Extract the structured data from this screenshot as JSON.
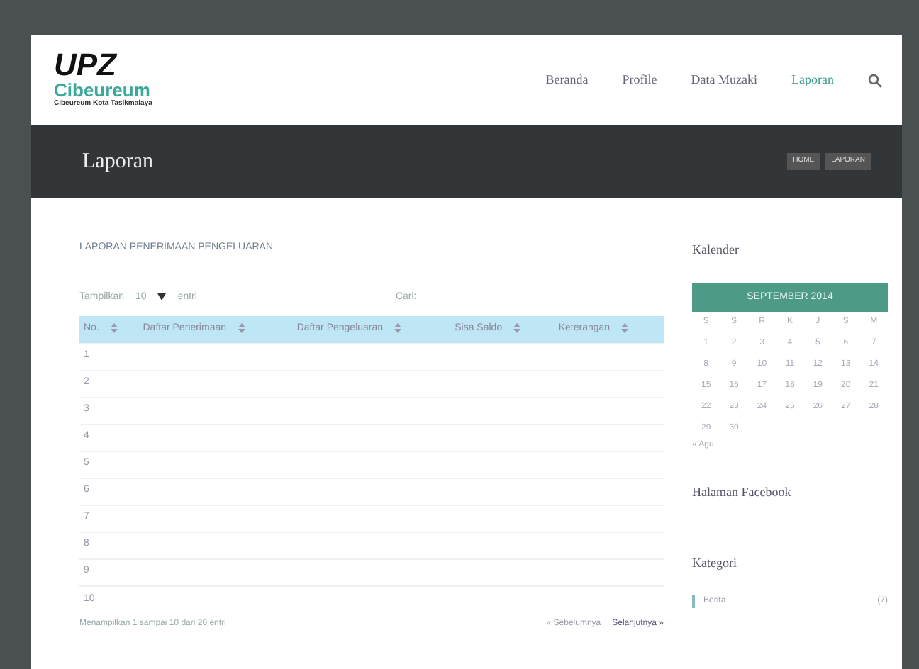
{
  "logo": {
    "mark": "UPZ",
    "name": "Cibeureum",
    "subtitle": "Cibeureum Kota Tasikmalaya"
  },
  "nav": [
    {
      "label": "Beranda",
      "selected": false
    },
    {
      "label": "Profile",
      "selected": false
    },
    {
      "label": "Data Muzaki",
      "selected": false
    },
    {
      "label": "Laporan",
      "selected": true
    }
  ],
  "page_title": "Laporan",
  "breadcrumb": [
    "HOME",
    "LAPORAN"
  ],
  "report": {
    "title": "LAPORAN PENERIMAAN PENGELUARAN",
    "show_label": "Tampilkan",
    "page_size": "10",
    "entries_label": "entri",
    "search_label": "Cari:",
    "columns": [
      "No.",
      "Daftar Penerimaan",
      "Daftar Pengeluaran",
      "Sisa Saldo",
      "Keterangan"
    ],
    "rows": [
      "1",
      "2",
      "3",
      "4",
      "5",
      "6",
      "7",
      "8",
      "9",
      "10"
    ],
    "info": "Menampilkan 1 sampai 10 dari 20 entri",
    "prev": "« Sebelumnya",
    "next": "Selanjutnya »"
  },
  "sidebar": {
    "calendar_title": "Kalender",
    "month": "SEPTEMBER 2014",
    "weekdays": [
      "S",
      "S",
      "R",
      "K",
      "J",
      "S",
      "M"
    ],
    "weeks": [
      [
        "1",
        "2",
        "3",
        "4",
        "5",
        "6",
        "7"
      ],
      [
        "8",
        "9",
        "10",
        "11",
        "12",
        "13",
        "14"
      ],
      [
        "15",
        "16",
        "17",
        "18",
        "19",
        "20",
        "21"
      ],
      [
        "22",
        "23",
        "24",
        "25",
        "26",
        "27",
        "28"
      ],
      [
        "29",
        "30"
      ]
    ],
    "prev_month": "« Agu",
    "facebook_title": "Halaman Facebook",
    "category_title": "Kategori",
    "categories": [
      {
        "name": "Berita",
        "count": "(7)"
      }
    ]
  }
}
